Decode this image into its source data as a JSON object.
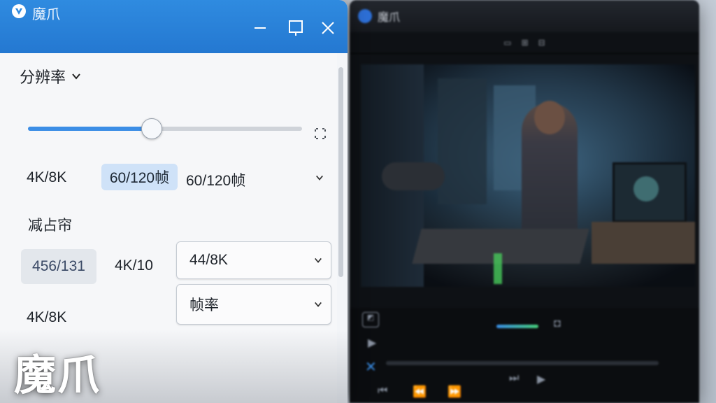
{
  "app": {
    "title": "魔爪",
    "brand_overlay": "魔爪",
    "accent": "#2f8be0"
  },
  "settings": {
    "resolution_header": "分辨率",
    "slider": {
      "value": 0.45
    },
    "row1": {
      "left": "4K/8K",
      "selected": "60/120帧",
      "right": "60/120帧"
    },
    "section2_header": "减占帘",
    "row2": {
      "pill": "456/131",
      "middle": "4K/10",
      "dropdown": "44/8K"
    },
    "row3": {
      "left": "4K/8K",
      "dropdown": "帧率"
    }
  },
  "player": {
    "title": "魔爪",
    "progress_colors": [
      "#3a8fe8",
      "#46d07a"
    ]
  }
}
